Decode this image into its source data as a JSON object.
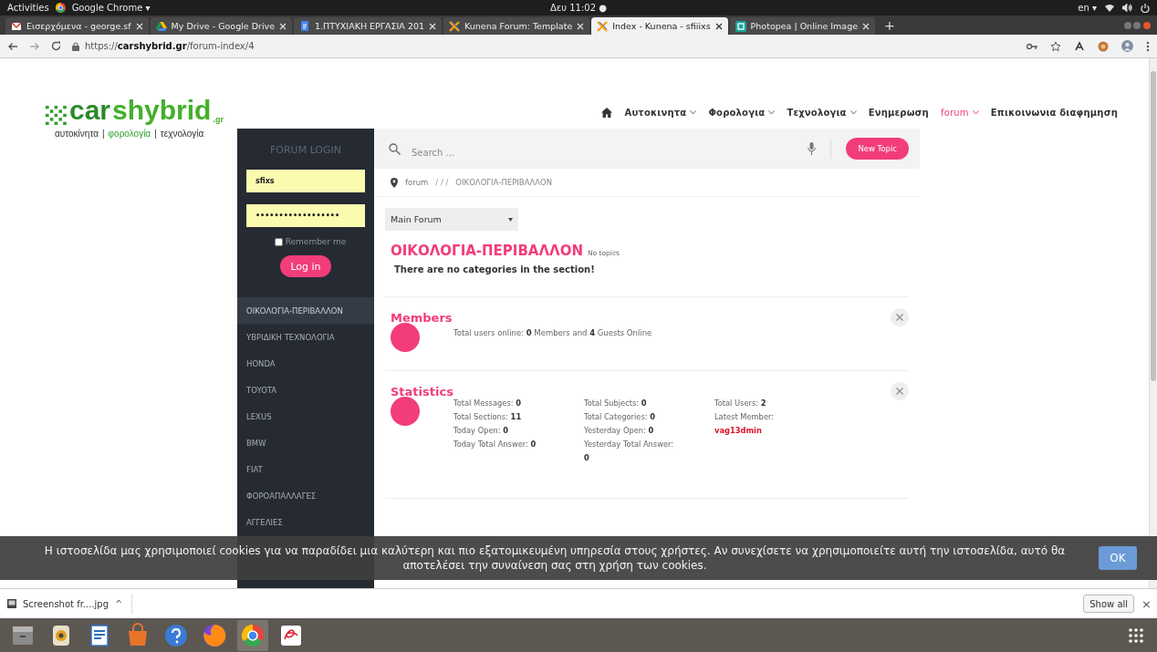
{
  "system_bar": {
    "activities": "Activities",
    "app": "Google Chrome ▾",
    "clock": "Δευ 11:02 ●",
    "language": "en ▾"
  },
  "browser": {
    "tabs": [
      {
        "title": "Εισερχόμενα - george.sf",
        "selected": false
      },
      {
        "title": "My Drive - Google Drive",
        "selected": false
      },
      {
        "title": "1.ΠΤΥΧΙΑΚΗ ΕΡΓΑΣΙΑ 201",
        "selected": false
      },
      {
        "title": "Kunena Forum: Template",
        "selected": false
      },
      {
        "title": "Index - Kunena - sfiiixs",
        "selected": true
      },
      {
        "title": "Photopea | Online Image",
        "selected": false
      }
    ],
    "new_tab": "+",
    "url": "https://**carshybrid.gr**/forum-index/4"
  },
  "site": {
    "logo": {
      "part_1": "car",
      "part_2": "shybrid",
      "suffix": ".gr"
    },
    "tagline": [
      {
        "text": "αυτοκίνητα",
        "highlighted": false
      },
      {
        "text": "φορολογία",
        "highlighted": true
      },
      {
        "text": "τεχνολογία",
        "highlighted": false
      }
    ],
    "tagline_separator": "|",
    "nav": [
      {
        "label": "Αυτοκινητα",
        "has_menu": true,
        "selected": false
      },
      {
        "label": "Φορολογια",
        "has_menu": true,
        "selected": false
      },
      {
        "label": "Τεχνολογια",
        "has_menu": true,
        "selected": false
      },
      {
        "label": "Ενημερωση",
        "has_menu": false,
        "selected": false
      },
      {
        "label": "forum",
        "has_menu": true,
        "selected": true
      },
      {
        "label": "Επικοινωνια διαφημηση",
        "has_menu": false,
        "selected": false
      }
    ]
  },
  "sidebar": {
    "login": {
      "title": "FORUM LOGIN",
      "username": "sfixs",
      "password": "••••••••••••••••••",
      "remember_label": "Remember me",
      "remember_checked": false,
      "button": "Log in"
    },
    "items": [
      {
        "label": "ΟΙΚΟΛΟΓΙΑ-ΠΕΡΙΒΑΛΛΟΝ",
        "selected": true
      },
      {
        "label": "ΥΒΡΙΔΙΚΗ ΤΕΧΝΟΛΟΓΙΑ",
        "selected": false
      },
      {
        "label": "HONDA",
        "selected": false
      },
      {
        "label": "TOYOTA",
        "selected": false
      },
      {
        "label": "LEXUS",
        "selected": false
      },
      {
        "label": "BMW",
        "selected": false
      },
      {
        "label": "FIAT",
        "selected": false
      },
      {
        "label": "ΦΟΡΟΑΠΑΛΛΑΓΕΣ",
        "selected": false
      },
      {
        "label": "ΑΓΓΕΛΙΕΣ",
        "selected": false
      }
    ]
  },
  "forum": {
    "search": {
      "placeholder": "Search ..."
    },
    "new_topic": "New Topic",
    "breadcrumb": {
      "home": "forum",
      "separators": "/ / /",
      "current": "ΟΙΚΟΛΟΓΙΑ-ΠΕΡΙΒΑΛΛΟΝ"
    },
    "forum_select": "Main Forum",
    "title": "ΟΙΚΟΛΟΓΙΑ-ΠΕΡΙΒΑΛΛΟΝ",
    "title_note": "No topics",
    "message": "There are no categories in the section!",
    "members": {
      "title": "Members",
      "text": "Total users online: **0** Members and **4** Guests Online"
    },
    "statistics": {
      "title": "Statistics",
      "columns": [
        [
          {
            "label": "Total Messages:",
            "value": "0",
            "kind": "number"
          },
          {
            "label": "Total Sections:",
            "value": "11",
            "kind": "number"
          },
          {
            "label": "Today Open:",
            "value": "0",
            "kind": "number"
          },
          {
            "label": "Today Total Answer:",
            "value": "0",
            "kind": "number"
          }
        ],
        [
          {
            "label": "Total Subjects:",
            "value": "0",
            "kind": "number"
          },
          {
            "label": "Total Categories:",
            "value": "0",
            "kind": "number"
          },
          {
            "label": "Yesterday Open:",
            "value": "0",
            "kind": "number"
          },
          {
            "label": "Yesterday Total Answer:",
            "value": "0",
            "kind": "wrapped"
          }
        ],
        [
          {
            "label": "Total Users:",
            "value": "2",
            "kind": "number"
          },
          {
            "label": "Latest Member:",
            "value": "vag13dmin",
            "kind": "member"
          }
        ]
      ]
    }
  },
  "cookie_bar": {
    "text": "Η ιστοσελίδα μας χρησιμοποιεί cookies για να παραδίδει μια καλύτερη και πιο εξατομικευμένη υπηρεσία στους χρήστες. Αν συνεχίσετε να χρησιμοποιείτε αυτή την ιστοσελίδα, αυτό θα αποτελέσει την συναίνεση σας στη χρήση των cookies.",
    "button": "OK"
  },
  "download_bar": {
    "file": "Screenshot fr....jpg",
    "caret": "^",
    "show_all": "Show all",
    "close": "×"
  },
  "dock": {
    "apps": [
      {
        "active": false
      },
      {
        "active": false
      },
      {
        "active": false
      },
      {
        "active": false
      },
      {
        "active": false
      },
      {
        "active": false
      },
      {
        "active": true
      },
      {
        "active": false
      }
    ]
  }
}
